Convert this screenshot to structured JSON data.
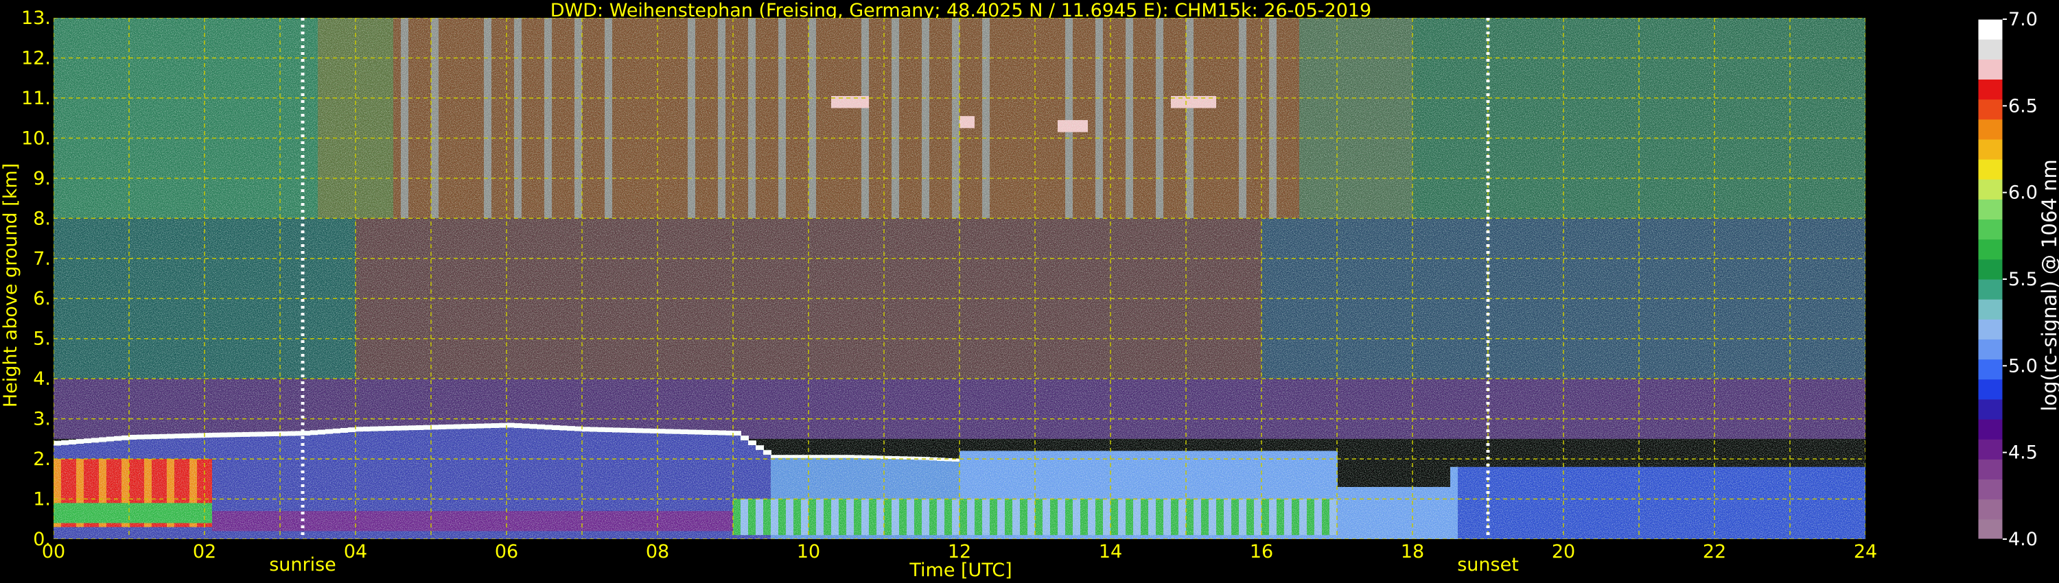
{
  "chart_data": {
    "type": "heatmap",
    "title": "DWD: Weihenstephan (Freising, Germany; 48.4025 N / 11.6945 E):    CHM15k: 26-05-2019",
    "xlabel": "Time [UTC]",
    "ylabel": "Height above ground [km]",
    "xlim": [
      0,
      24
    ],
    "ylim": [
      0,
      13
    ],
    "x_ticks": [
      "00",
      "02",
      "04",
      "06",
      "08",
      "10",
      "12",
      "14",
      "16",
      "18",
      "20",
      "22",
      "24"
    ],
    "y_ticks": [
      "0.",
      "1.",
      "2.",
      "3.",
      "4.",
      "5.",
      "6.",
      "7.",
      "8.",
      "9.",
      "10.",
      "11.",
      "12.",
      "13."
    ],
    "grid": true,
    "sunrise": {
      "label": "sunrise",
      "time_h": 3.3
    },
    "sunset": {
      "label": "sunset",
      "time_h": 19.0
    },
    "colorbar": {
      "label": "log(rc-signal) @ 1064 nm",
      "range": [
        4.0,
        7.0
      ],
      "ticks": [
        "4.0",
        "4.5",
        "5.0",
        "5.5",
        "6.0",
        "6.5",
        "7.0"
      ],
      "colors": [
        "#a07a9a",
        "#9a6b96",
        "#8e5594",
        "#7f3d8f",
        "#6a1f8c",
        "#520a8c",
        "#2f1fae",
        "#1f3fe6",
        "#3a6cf5",
        "#6a98f2",
        "#8eb6ee",
        "#78c0c6",
        "#3aa584",
        "#1b9a45",
        "#2fb544",
        "#53c957",
        "#86dc6b",
        "#c6e85a",
        "#f2e21d",
        "#f3b618",
        "#f08a13",
        "#eb4a18",
        "#e41515",
        "#f2c4c8",
        "#dedede",
        "#ffffff"
      ]
    },
    "layers": {
      "boundary_layer_top_km": [
        [
          0,
          2.45
        ],
        [
          1,
          2.6
        ],
        [
          2,
          2.65
        ],
        [
          3.3,
          2.7
        ],
        [
          4,
          2.8
        ],
        [
          5,
          2.85
        ],
        [
          6,
          2.9
        ],
        [
          7,
          2.8
        ],
        [
          8,
          2.75
        ],
        [
          9,
          2.7
        ]
      ],
      "residual_layer_top_km": [
        [
          9.5,
          2.1
        ],
        [
          10.5,
          2.1
        ],
        [
          11.5,
          2.05
        ],
        [
          12,
          2.0
        ]
      ],
      "cirrus_patches": [
        {
          "t_start_h": 10.3,
          "t_end_h": 10.8,
          "h_km": 10.9
        },
        {
          "t_start_h": 12.0,
          "t_end_h": 12.2,
          "h_km": 10.4
        },
        {
          "t_start_h": 13.3,
          "t_end_h": 13.7,
          "h_km": 10.3
        },
        {
          "t_start_h": 14.8,
          "t_end_h": 15.4,
          "h_km": 10.9
        }
      ]
    }
  }
}
